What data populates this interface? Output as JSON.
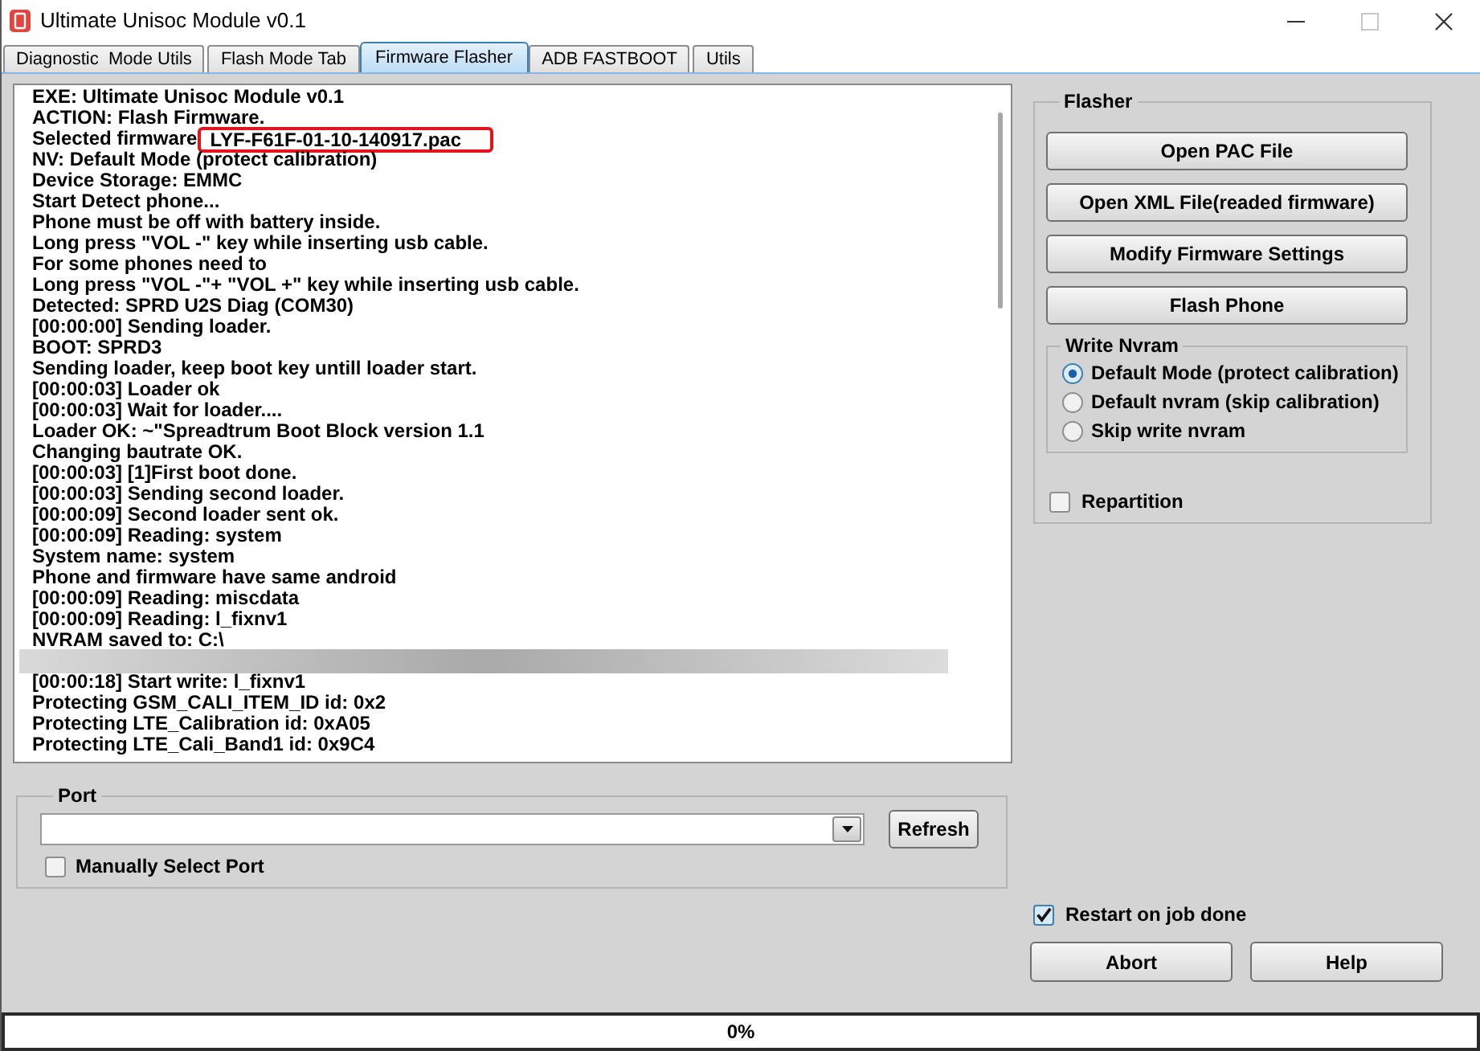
{
  "window": {
    "title": "Ultimate Unisoc Module v0.1",
    "maximize_disabled": true
  },
  "tabs": [
    {
      "label": "Diagnostic  Mode Utils",
      "selected": false
    },
    {
      "label": "Flash Mode Tab",
      "selected": false
    },
    {
      "label": "Firmware Flasher",
      "selected": true
    },
    {
      "label": "ADB FASTBOOT",
      "selected": false
    },
    {
      "label": "Utils",
      "selected": false
    }
  ],
  "log": {
    "lines": [
      {
        "kind": "text",
        "text": "EXE: Ultimate Unisoc Module v0.1"
      },
      {
        "kind": "text",
        "text": "ACTION: Flash Firmware."
      },
      {
        "kind": "highlight",
        "text": "Selected firmware",
        "highlight": "LYF-F61F-01-10-140917.pac"
      },
      {
        "kind": "text",
        "text": "NV: Default Mode (protect calibration)"
      },
      {
        "kind": "text",
        "text": "Device Storage: EMMC"
      },
      {
        "kind": "text",
        "text": "Start Detect phone..."
      },
      {
        "kind": "text",
        "text": "Phone must be off with battery inside."
      },
      {
        "kind": "text",
        "text": "Long press \"VOL -\" key while inserting usb cable."
      },
      {
        "kind": "text",
        "text": "For some phones need to"
      },
      {
        "kind": "text",
        "text": "Long press \"VOL -\"+ \"VOL +\" key while inserting usb cable."
      },
      {
        "kind": "text",
        "text": "Detected: SPRD U2S Diag (COM30)"
      },
      {
        "kind": "text",
        "text": "[00:00:00] Sending loader."
      },
      {
        "kind": "text",
        "text": "BOOT: SPRD3"
      },
      {
        "kind": "text",
        "text": "Sending loader, keep boot key untill loader start."
      },
      {
        "kind": "text",
        "text": "[00:00:03] Loader ok"
      },
      {
        "kind": "text",
        "text": "[00:00:03] Wait for loader...."
      },
      {
        "kind": "text",
        "text": "Loader OK: ~\"Spreadtrum Boot Block version 1.1"
      },
      {
        "kind": "text",
        "text": "Changing bautrate OK."
      },
      {
        "kind": "text",
        "text": "[00:00:03] [1]First boot done."
      },
      {
        "kind": "text",
        "text": "[00:00:03] Sending second loader."
      },
      {
        "kind": "text",
        "text": "[00:00:09] Second loader sent ok."
      },
      {
        "kind": "text",
        "text": "[00:00:09] Reading: system"
      },
      {
        "kind": "text",
        "text": "System name: system"
      },
      {
        "kind": "text",
        "text": "Phone and firmware have same android"
      },
      {
        "kind": "text",
        "text": "[00:00:09] Reading: miscdata"
      },
      {
        "kind": "text",
        "text": "[00:00:09] Reading: l_fixnv1"
      },
      {
        "kind": "text",
        "text": "NVRAM saved to: C:\\"
      },
      {
        "kind": "redacted"
      },
      {
        "kind": "text",
        "text": "[00:00:18] Start write: l_fixnv1"
      },
      {
        "kind": "text",
        "text": "Protecting GSM_CALI_ITEM_ID id: 0x2"
      },
      {
        "kind": "text",
        "text": "Protecting LTE_Calibration id: 0xA05"
      },
      {
        "kind": "text",
        "text": "Protecting LTE_Cali_Band1 id: 0x9C4"
      }
    ]
  },
  "port": {
    "title": "Port",
    "refresh_button": "Refresh",
    "manual_select": {
      "label": "Manually Select Port",
      "checked": false
    }
  },
  "flasher": {
    "title": "Flasher",
    "buttons": [
      "Open PAC File",
      "Open XML File(readed firmware)",
      "Modify Firmware Settings",
      "Flash Phone"
    ],
    "write_nvram": {
      "title": "Write Nvram",
      "options": [
        {
          "label": "Default Mode (protect calibration)",
          "selected": true
        },
        {
          "label": "Default nvram (skip calibration)",
          "selected": false
        },
        {
          "label": "Skip write nvram",
          "selected": false
        }
      ]
    },
    "repartition": {
      "label": "Repartition",
      "checked": false
    }
  },
  "restart_on_job_done": {
    "label": "Restart on job done",
    "checked": true
  },
  "actions": [
    "Abort",
    "Help"
  ],
  "progress": {
    "level": 0,
    "label": "0%"
  }
}
